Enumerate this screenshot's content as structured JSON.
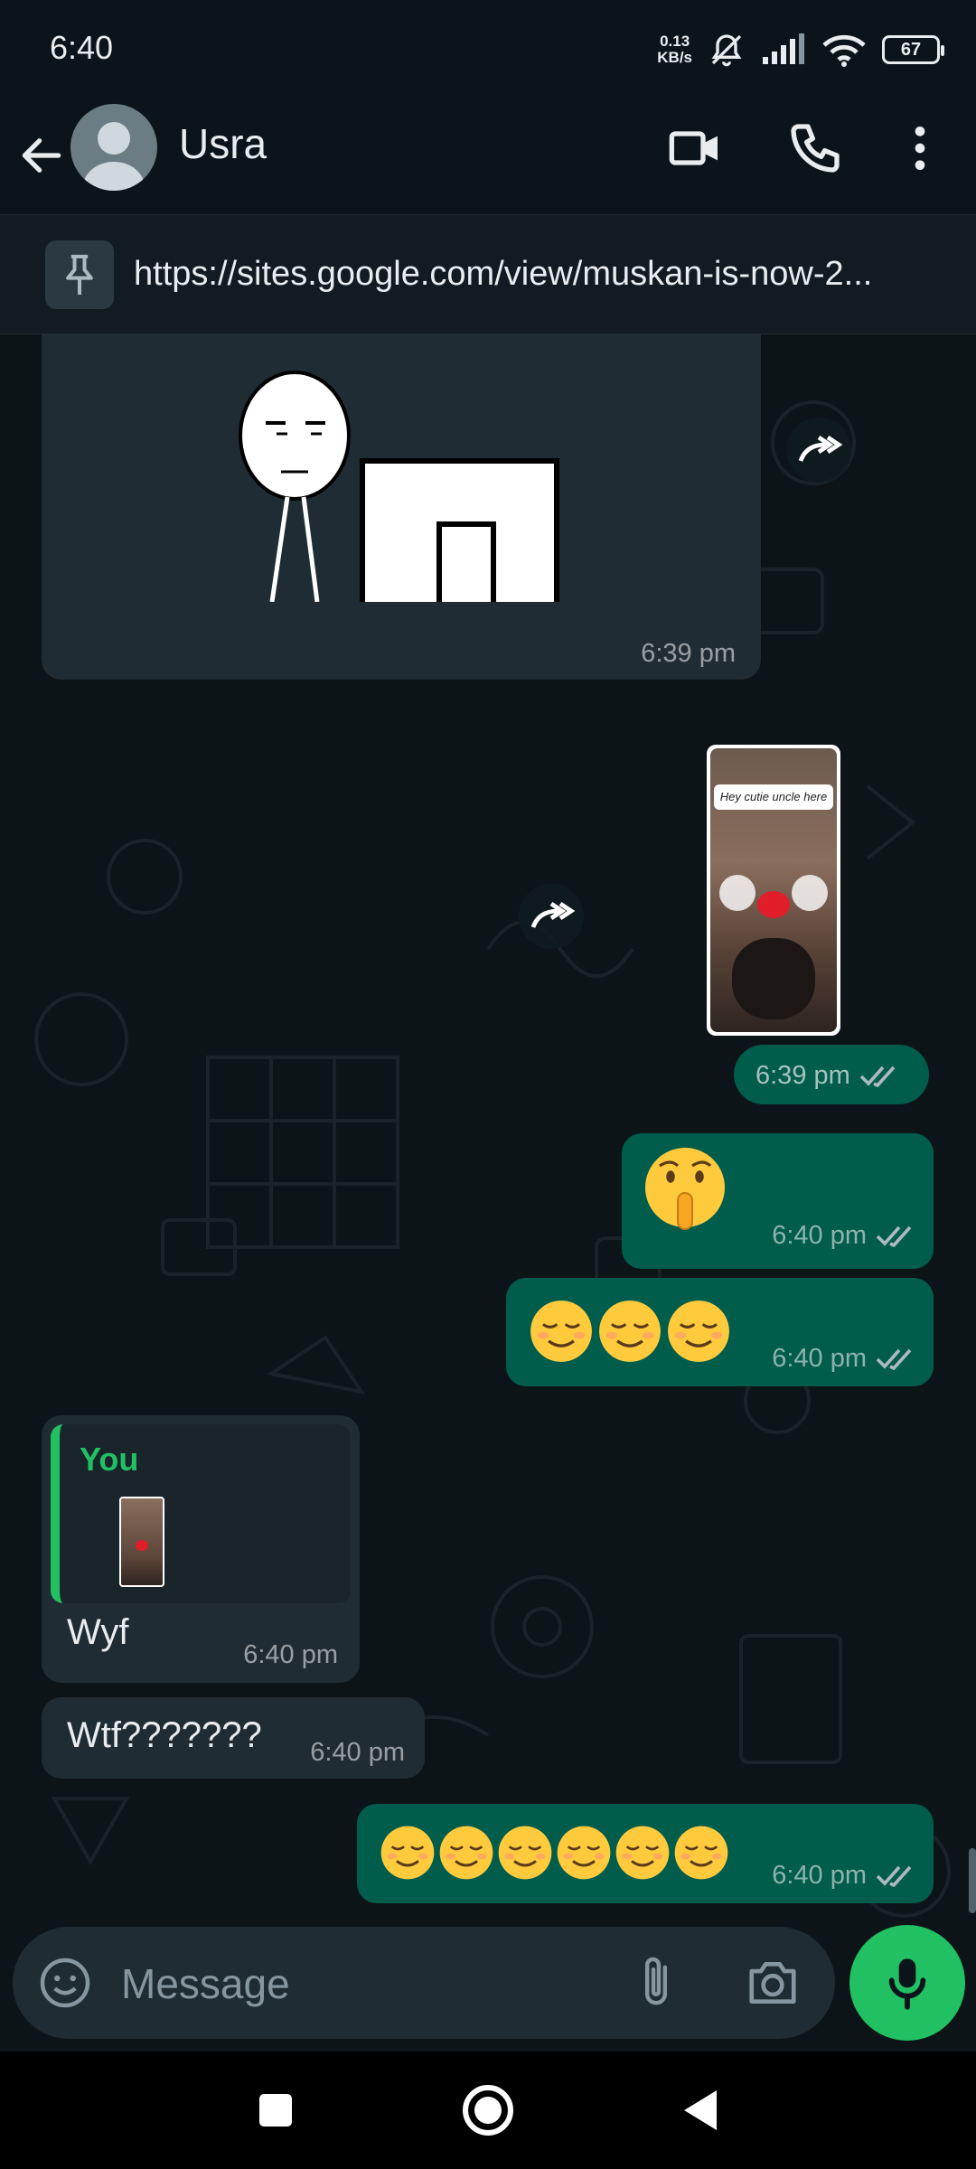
{
  "status_bar": {
    "time": "6:40",
    "net_speed_value": "0.13",
    "net_speed_unit": "KB/s",
    "battery": "67"
  },
  "header": {
    "contact_name": "Usra"
  },
  "pinned": {
    "text": "https://sites.google.com/view/muskan-is-now-2..."
  },
  "messages": {
    "m1": {
      "time": "6:39 pm"
    },
    "m2": {
      "time": "6:39 pm",
      "sticker_text": "Hey cutie uncle here"
    },
    "m3": {
      "time": "6:40 pm",
      "emoji": "shushing-face"
    },
    "m4": {
      "time": "6:40 pm",
      "emoji": "relieved-face x3"
    },
    "m5": {
      "quote_author": "You",
      "text": "Wyf",
      "time": "6:40 pm"
    },
    "m6": {
      "text": "Wtf???????",
      "time": "6:40 pm"
    },
    "m7": {
      "time": "6:40 pm",
      "emoji": "relieved-face x6"
    }
  },
  "input": {
    "placeholder": "Message"
  },
  "colors": {
    "outgoing_bubble": "#005c4b",
    "incoming_bubble": "#202c33",
    "accent_green": "#21c063",
    "quote_author": "#21c063"
  }
}
